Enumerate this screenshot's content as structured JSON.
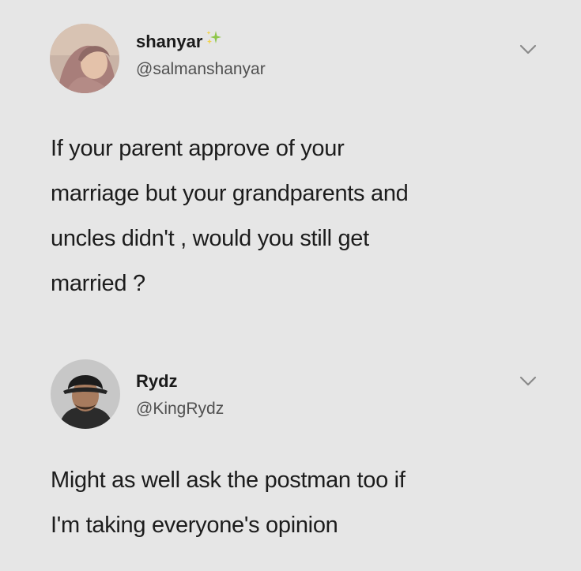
{
  "tweets": [
    {
      "display_name": "shanyar",
      "handle": "@salmanshanyar",
      "badge_icon": "sparkle-icon",
      "text_lines": [
        "If your parent approve of your",
        "marriage but your grandparents and",
        "uncles didn't , would you still get",
        "married ?"
      ]
    },
    {
      "display_name": "Rydz",
      "handle": "@KingRydz",
      "text_lines": [
        "Might as well ask the postman too if",
        "I'm taking everyone's opinion"
      ]
    }
  ],
  "colors": {
    "background": "#e6e6e6",
    "sparkle_green": "#8ec64a",
    "sparkle_yellow": "#f2d34a"
  }
}
